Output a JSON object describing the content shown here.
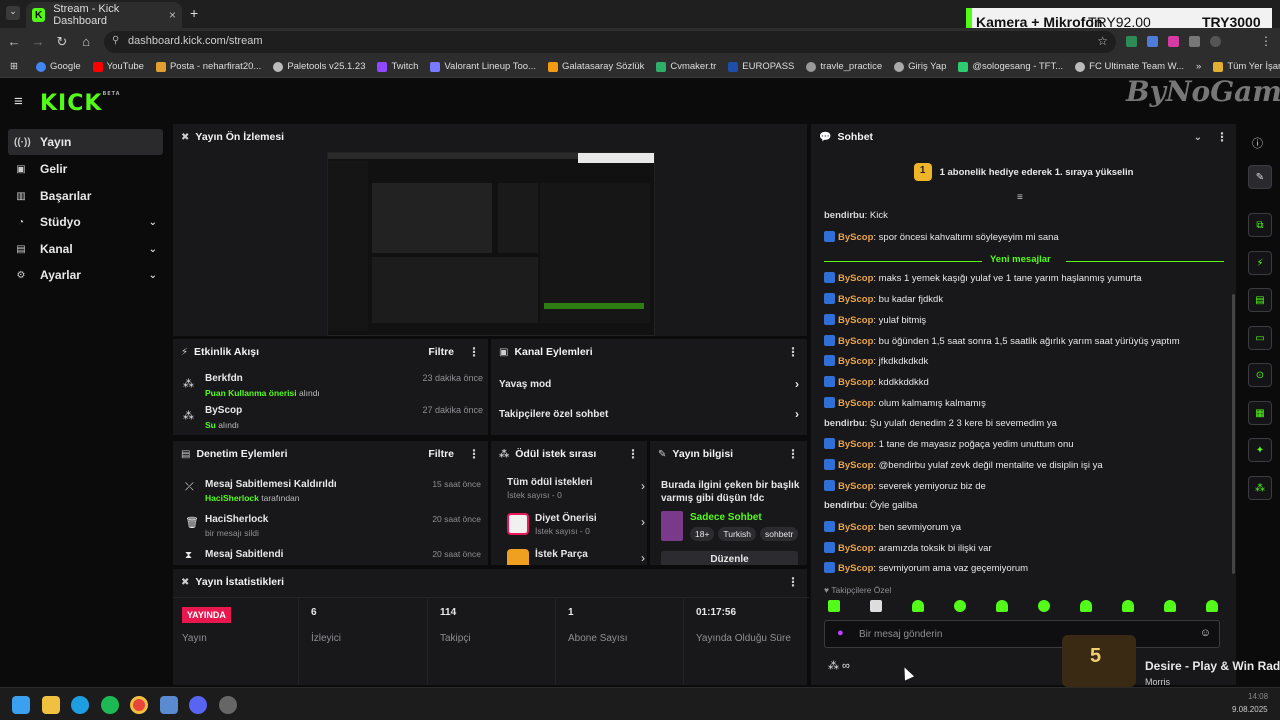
{
  "browser": {
    "tab_title": "Stream - Kick Dashboard",
    "tab_close": "×",
    "new_tab": "+",
    "url": "dashboard.kick.com/stream",
    "bookmarks": [
      "Google",
      "YouTube",
      "Posta - neharfirat20...",
      "Paletools v25.1.23",
      "Twitch",
      "Valorant Lineup Too...",
      "Galatasaray Sözlük",
      "Cvmaker.tr",
      "EUROPASS",
      "travle_practice",
      "Giriş Yap",
      "@sologesang - TFT...",
      "FC Ultimate Team W..."
    ],
    "bookmarks_more": "»",
    "all_bookmarks": "Tüm Yer İşaretleri"
  },
  "overlay": {
    "label": "Kamera + Mikrofon",
    "price1": "TRY92.00",
    "price2": "TRY3000"
  },
  "watermark": "ByNoGame",
  "brand": {
    "logo": "KICK",
    "beta": "BETA"
  },
  "sidebar": {
    "items": [
      {
        "label": "Yayın",
        "icon": "((·))"
      },
      {
        "label": "Gelir",
        "icon": "▣"
      },
      {
        "label": "Başarılar",
        "icon": "▥"
      },
      {
        "label": "Stüdyo",
        "icon": "◔"
      },
      {
        "label": "Kanal",
        "icon": "▤"
      },
      {
        "label": "Ayarlar",
        "icon": "⚙"
      }
    ],
    "chevron": "⌄"
  },
  "preview": {
    "title": "Yayın Ön İzlemesi"
  },
  "activity": {
    "title": "Etkinlik Akışı",
    "filter": "Filtre",
    "items": [
      {
        "user": "Berkfdn",
        "action": "Puan Kullanma önerisi",
        "suffix": " alındı",
        "time": "23 dakika önce"
      },
      {
        "user": "ByScop",
        "action": "Su",
        "suffix": " alındı",
        "time": "27 dakika önce"
      }
    ]
  },
  "channel_actions": {
    "title": "Kanal Eylemleri",
    "items": [
      "Yavaş mod",
      "Takipçilere özel sohbet"
    ]
  },
  "moderation": {
    "title": "Denetim Eylemleri",
    "filter": "Filtre",
    "items": [
      {
        "title": "Mesaj Sabitlemesi Kaldırıldı",
        "user": "HaciSherlock",
        "suffix": " tarafından",
        "time": "15 saat önce"
      },
      {
        "title": "HaciSherlock",
        "sub": "bir mesajı sildi",
        "time": "20 saat önce"
      },
      {
        "title": "Mesaj Sabitlendi",
        "time": "20 saat önce"
      }
    ]
  },
  "rewards": {
    "title": "Ödül istek sırası",
    "items": [
      {
        "title": "Tüm ödül istekleri",
        "sub": "İstek sayısı - 0"
      },
      {
        "title": "Diyet Önerisi",
        "sub": "İstek sayısı - 0"
      },
      {
        "title": "İstek Parça",
        "sub": ""
      }
    ]
  },
  "stream_info": {
    "title": "Yayın bilgisi",
    "stream_title": "Burada ilgini çeken bir başlık varmış gibi düşün !dc",
    "category": "Sadece Sohbet",
    "tags": [
      "18+",
      "Turkish",
      "sohbetr"
    ],
    "edit": "Düzenle"
  },
  "stats": {
    "title": "Yayın İstatistikleri",
    "live_badge": "YAYINDA",
    "cells": [
      {
        "value": "",
        "label": "Yayın"
      },
      {
        "value": "6",
        "label": "İzleyici"
      },
      {
        "value": "114",
        "label": "Takipçi"
      },
      {
        "value": "1",
        "label": "Abone Sayısı"
      },
      {
        "value": "01:17:56",
        "label": "Yayında Olduğu Süre"
      }
    ]
  },
  "chat": {
    "title": "Sohbet",
    "gift_banner": "1 abonelik hediye ederek 1. sıraya yükselin",
    "gift_rank": "1",
    "new_messages": "Yeni mesajlar",
    "followers_only": "Takipçilere Özel",
    "placeholder": "Bir mesaj gönderin",
    "messages": [
      {
        "user": "bendirbu",
        "text": "Kick",
        "badge": false
      },
      {
        "user": "ByScop",
        "text": "spor öncesi kahvaltımı söyleyeyim mi sana",
        "badge": true
      },
      {
        "user": "ByScop",
        "text": "maks 1 yemek kaşığı yulaf ve 1 tane yarım haşlanmış yumurta",
        "badge": true
      },
      {
        "user": "ByScop",
        "text": "bu kadar fjdkdk",
        "badge": true
      },
      {
        "user": "ByScop",
        "text": "yulaf bitmiş",
        "badge": true
      },
      {
        "user": "ByScop",
        "text": "bu öğünden 1,5 saat sonra 1,5 saatlik ağırlık yarım saat yürüyüş yaptım",
        "badge": true
      },
      {
        "user": "ByScop",
        "text": "jfkdkdkdkdk",
        "badge": true
      },
      {
        "user": "ByScop",
        "text": "kddkkddkkd",
        "badge": true
      },
      {
        "user": "ByScop",
        "text": "olum kalmamış kalmamış",
        "badge": true
      },
      {
        "user": "bendirbu",
        "text": "Şu yulafı denedim 2 3 kere bi sevemedim ya",
        "badge": false
      },
      {
        "user": "ByScop",
        "text": "1 tane de mayasız poğaça yedim unuttum onu",
        "badge": true
      },
      {
        "user": "ByScop",
        "text": "@bendirbu yulaf zevk değil mentalite ve disiplin işi ya",
        "badge": true
      },
      {
        "user": "ByScop",
        "text": "severek yemiyoruz biz de",
        "badge": true
      },
      {
        "user": "bendirbu",
        "text": "Öyle galiba",
        "badge": false
      },
      {
        "user": "ByScop",
        "text": "ben sevmiyorum ya",
        "badge": true
      },
      {
        "user": "ByScop",
        "text": "aramızda toksik bi ilişki var",
        "badge": true
      },
      {
        "user": "ByScop",
        "text": "sevmiyorum ama vaz geçemiyorum",
        "badge": true
      }
    ]
  },
  "now_playing": {
    "title": "Desire - Play & Win Radio",
    "artist": "Morris",
    "badge_number": "5"
  },
  "taskbar": {
    "time": "14:08",
    "date": "9.08.2025"
  },
  "colors": {
    "accent": "#53fc18",
    "live": "#e8184f",
    "username": "#e8a54b"
  }
}
